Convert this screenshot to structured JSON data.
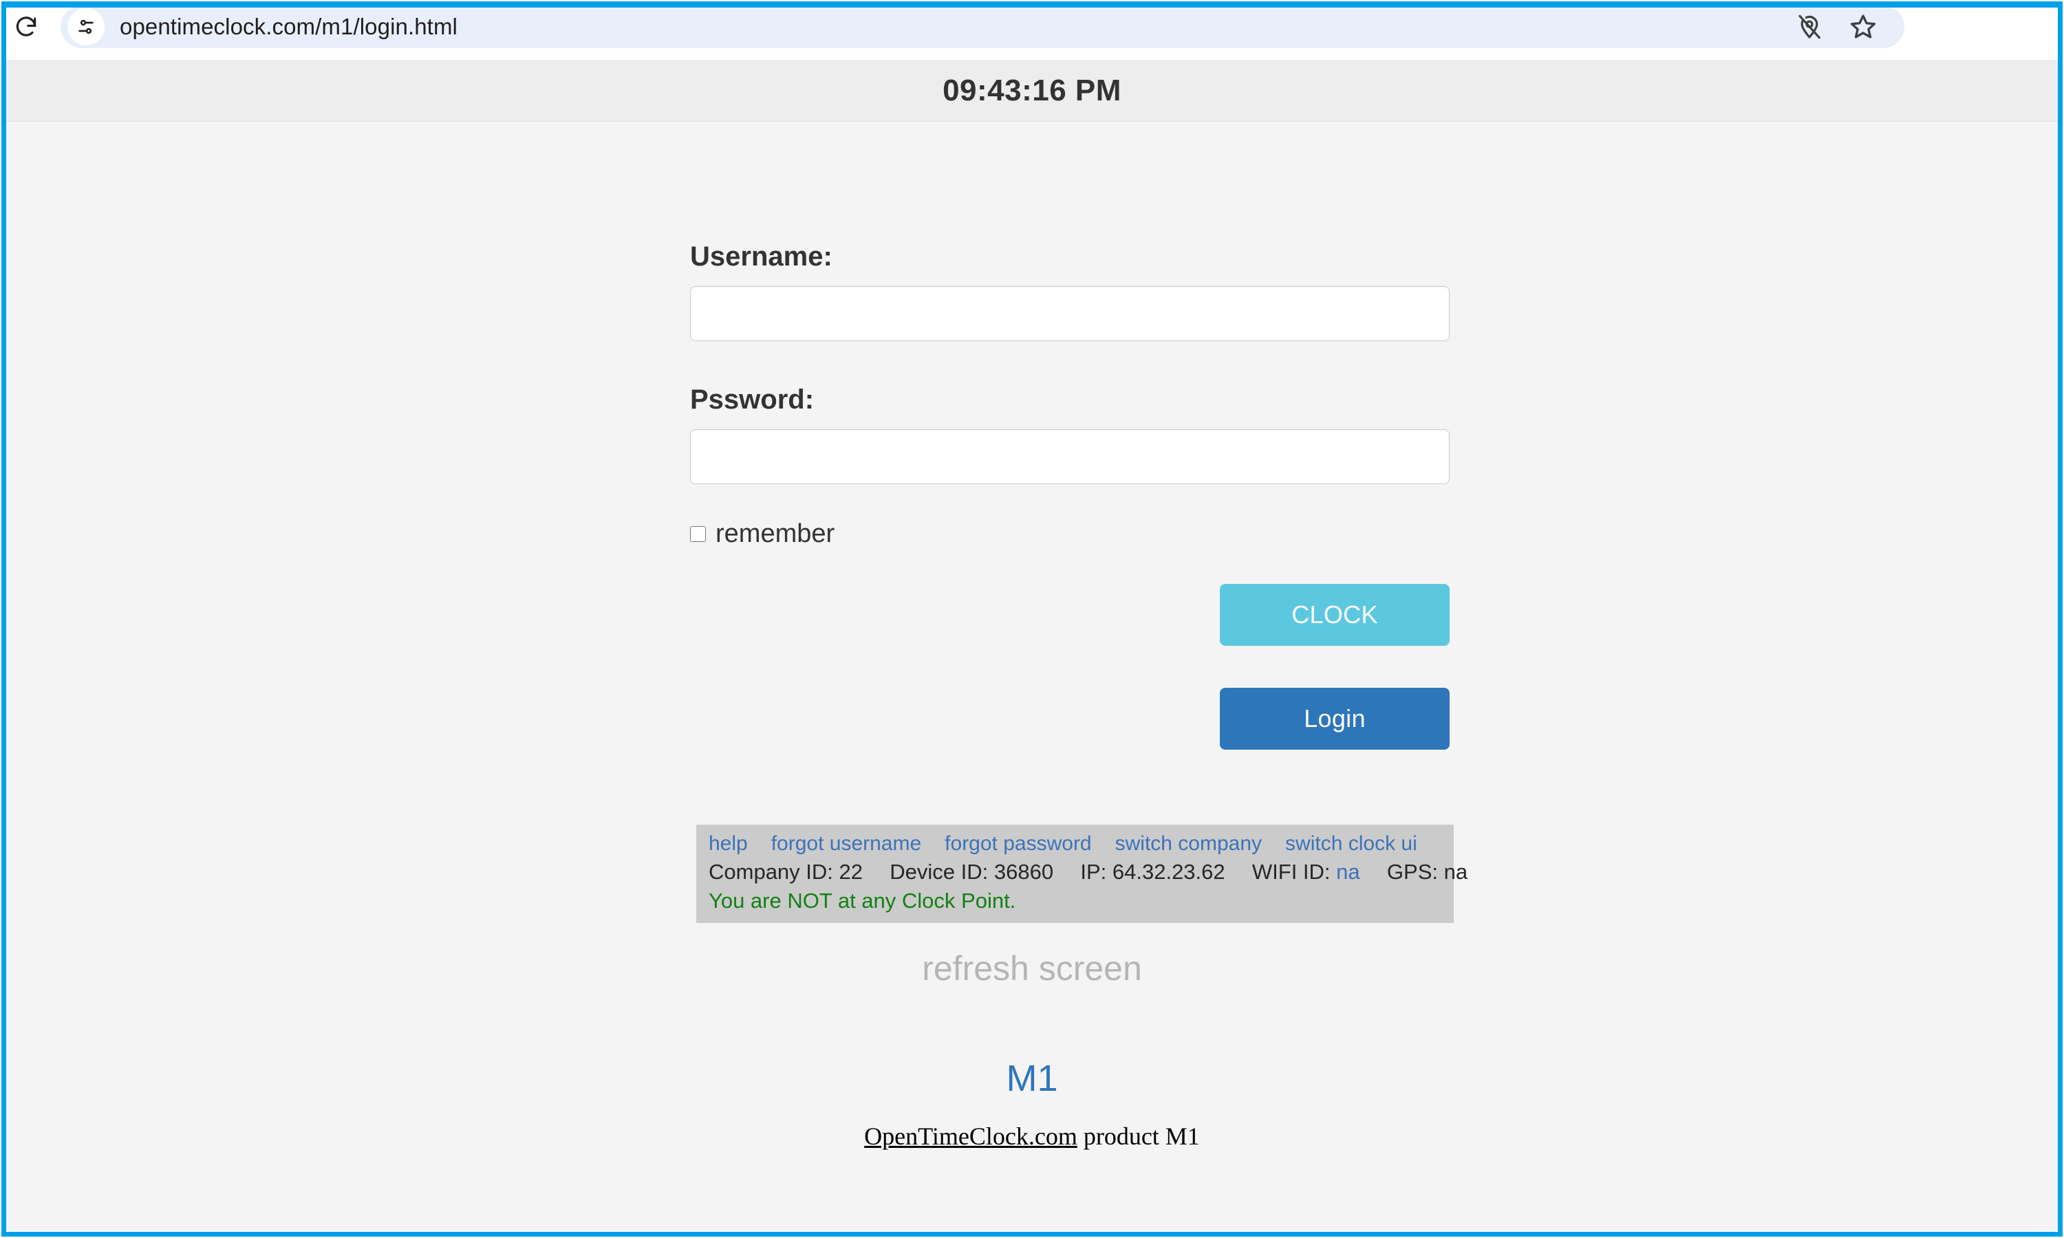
{
  "browser": {
    "reload_icon": "reload-icon",
    "site_settings_icon": "site-settings-sliders-icon",
    "url": "opentimeclock.com/m1/login.html",
    "actions": [
      {
        "icon": "location-blocked-icon",
        "name": "location-blocked-icon"
      },
      {
        "icon": "bookmark-star-icon",
        "name": "bookmark-star-icon"
      }
    ]
  },
  "header": {
    "time": "09:43:16 PM"
  },
  "form": {
    "username_label": "Username:",
    "username_value": "",
    "username_placeholder": "",
    "password_label": "Pssword:",
    "password_value": "",
    "password_placeholder": "",
    "remember_label": "remember",
    "remember_checked": false,
    "clock_button": "CLOCK",
    "login_button": "Login"
  },
  "info": {
    "links": [
      {
        "label": "help"
      },
      {
        "label": "forgot username"
      },
      {
        "label": "forgot password"
      },
      {
        "label": "switch company"
      },
      {
        "label": "switch clock ui"
      }
    ],
    "meta": {
      "company_id_label": "Company ID:",
      "company_id_value": "22",
      "device_id_label": "Device ID:",
      "device_id_value": "36860",
      "ip_label": "IP:",
      "ip_value": "64.32.23.62",
      "wifi_label": "WIFI ID:",
      "wifi_value": "na",
      "gps_label": "GPS:",
      "gps_value": "na"
    },
    "status": "You are NOT at any Clock Point."
  },
  "footer": {
    "refresh": "refresh screen",
    "product_tag": "M1",
    "site_link": "OpenTimeClock.com",
    "product_text": " product M1"
  },
  "colors": {
    "frame": "#00a0e9",
    "clock_button": "#5bc8e0",
    "login_button": "#2e76ba",
    "link": "#3d72b8",
    "status_green": "#138013",
    "panel_bg": "#cbcbcb",
    "header_bg": "#ededed",
    "page_bg": "#f4f4f4"
  }
}
